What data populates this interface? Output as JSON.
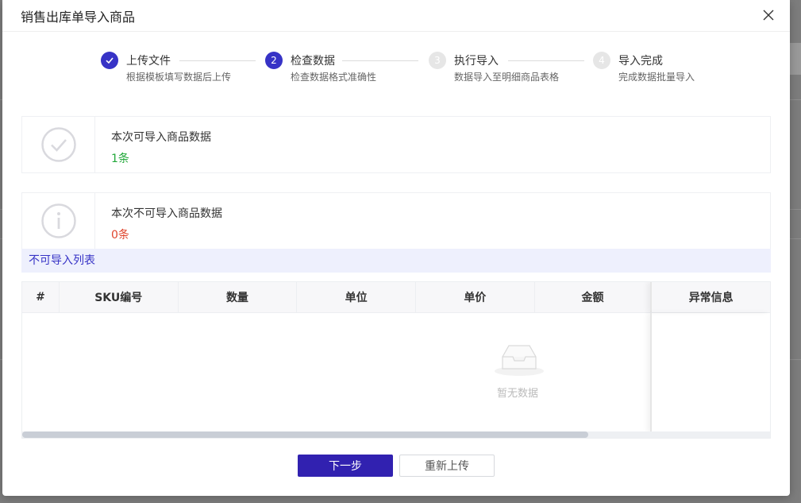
{
  "dialog": {
    "title": "销售出库单导入商品"
  },
  "steps": [
    {
      "number": "1",
      "title": "上传文件",
      "desc": "根据模板填写数据后上传",
      "status": "done"
    },
    {
      "number": "2",
      "title": "检查数据",
      "desc": "检查数据格式准确性",
      "status": "active"
    },
    {
      "number": "3",
      "title": "执行导入",
      "desc": "数据导入至明细商品表格",
      "status": "todo"
    },
    {
      "number": "4",
      "title": "导入完成",
      "desc": "完成数据批量导入",
      "status": "todo"
    }
  ],
  "results": {
    "importable": {
      "label": "本次可导入商品数据",
      "count": "1条"
    },
    "not_importable": {
      "label": "本次不可导入商品数据",
      "count": "0条"
    }
  },
  "section": {
    "title": "不可导入列表"
  },
  "table": {
    "columns": [
      "#",
      "SKU编号",
      "数量",
      "单位",
      "单价",
      "金额",
      "异常信息"
    ],
    "rows": [],
    "empty_text": "暂无数据"
  },
  "footer": {
    "next_label": "下一步",
    "reupload_label": "重新上传"
  },
  "colors": {
    "primary": "#3121b0",
    "step_active": "#3733c6",
    "success": "#22a83a",
    "error": "#e0452d"
  }
}
